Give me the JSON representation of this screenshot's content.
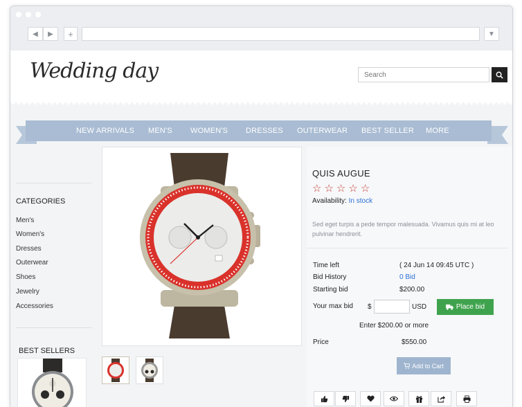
{
  "header": {
    "logo_text": "Wedding day",
    "search_placeholder": "Search"
  },
  "menu": {
    "items": [
      "NEW ARRIVALS",
      "MEN'S",
      "WOMEN'S",
      "DRESSES",
      "OUTERWEAR",
      "BEST SELLER",
      "MORE"
    ]
  },
  "sidebar": {
    "categories_title": "CATEGORIES",
    "categories": [
      "Men's",
      "Women's",
      "Dresses",
      "Outerwear",
      "Shoes",
      "Jewelry",
      "Accessories"
    ],
    "best_sellers_title": "BEST SELLERS"
  },
  "product": {
    "title": "QUIS AUGUE",
    "rating": 0,
    "rating_max": 5,
    "availability_label": "Availability:",
    "availability_value": "In stock",
    "description": "Sed eget turpis a pede tempor malesuada. Vivamus quis mi at leo pulvinar hendrerit."
  },
  "auction": {
    "time_left_label": "Time left",
    "time_left_value": "( 24 Jun 14 09:45 UTC )",
    "bid_history_label": "Bid History",
    "bid_history_value": "0 Bid",
    "starting_bid_label": "Starting bid",
    "starting_bid_value": "$200.00",
    "max_bid_label": "Your max bid",
    "currency_symbol": "$",
    "currency_code": "USD",
    "max_bid_value": "",
    "place_bid_label": "Place bid",
    "enter_hint": "Enter $200.00 or more",
    "price_label": "Price",
    "price_value": "$550.00",
    "add_to_cart_label": "Add to Cart"
  },
  "actions": [
    "thumbs-up-icon",
    "thumbs-down-icon",
    "heart-icon",
    "eye-icon",
    "gift-icon",
    "share-icon",
    "print-icon"
  ],
  "colors": {
    "menu_bg": "#a9bcd3",
    "place_bid": "#3fa34d",
    "add_to_cart": "#9fb5cf",
    "link_blue": "#2a6fd6",
    "star_red": "#c0392b"
  }
}
